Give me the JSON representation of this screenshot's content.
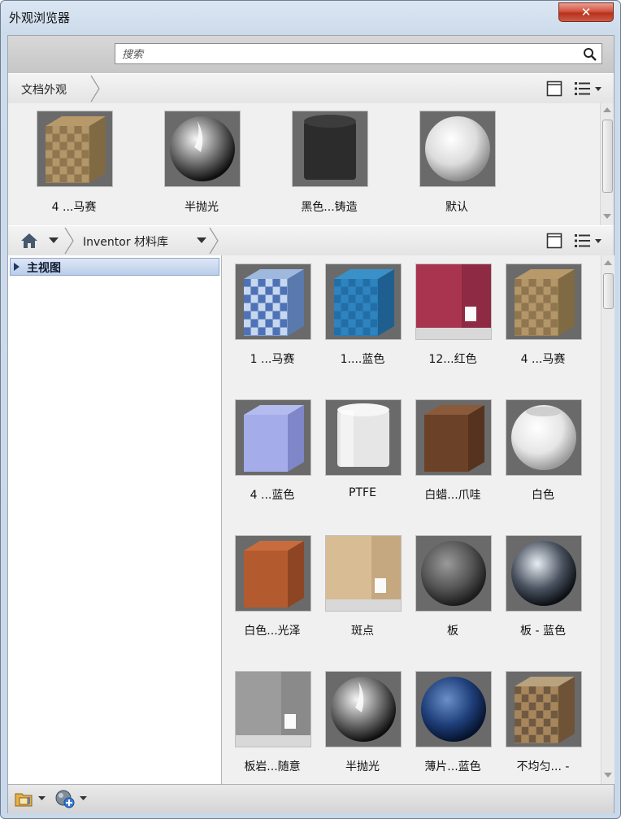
{
  "window": {
    "title": "外观浏览器",
    "close_glyph": "✕"
  },
  "search": {
    "placeholder": "搜索",
    "value": ""
  },
  "doc_bar": {
    "label": "文档外观"
  },
  "doc_items": [
    {
      "label": "4 ...马赛",
      "texture": "tiles-tan"
    },
    {
      "label": "半抛光",
      "texture": "sphere-chrome"
    },
    {
      "label": "黑色...铸造",
      "texture": "cylinder-black"
    },
    {
      "label": "默认",
      "texture": "sphere-white"
    }
  ],
  "lib_bar": {
    "label": "Inventor 材料库"
  },
  "tree": {
    "items": [
      {
        "label": "主视图"
      }
    ]
  },
  "lib_items": [
    {
      "label": "1 ...马赛",
      "texture": "tiles-blue-mosaic"
    },
    {
      "label": "1....蓝色",
      "texture": "tiles-blue"
    },
    {
      "label": "12...红色",
      "texture": "wall-red"
    },
    {
      "label": "4 ...马赛",
      "texture": "tiles-tan"
    },
    {
      "label": "4 ...蓝色",
      "texture": "cube-lavender"
    },
    {
      "label": "PTFE",
      "texture": "cylinder-white"
    },
    {
      "label": "白蜡...爪哇",
      "texture": "cube-wood"
    },
    {
      "label": "白色",
      "texture": "pot-white"
    },
    {
      "label": "白色...光泽",
      "texture": "cube-orange"
    },
    {
      "label": "斑点",
      "texture": "wall-beige"
    },
    {
      "label": "板",
      "texture": "sphere-granite"
    },
    {
      "label": "板 - 蓝色",
      "texture": "sphere-chrome-dark"
    },
    {
      "label": "板岩...随意",
      "texture": "wall-slate"
    },
    {
      "label": "半抛光",
      "texture": "sphere-chrome"
    },
    {
      "label": "薄片...蓝色",
      "texture": "sphere-blue-metal"
    },
    {
      "label": "不均匀... -",
      "texture": "cube-stone"
    }
  ],
  "icons": {
    "search": "search-icon",
    "home": "home-icon",
    "view": "single-view-icon",
    "list": "list-view-icon",
    "folder": "folder-icon",
    "add": "add-material-icon"
  },
  "colors": {
    "selection": "#b9cdea",
    "close": "#c94a35"
  }
}
